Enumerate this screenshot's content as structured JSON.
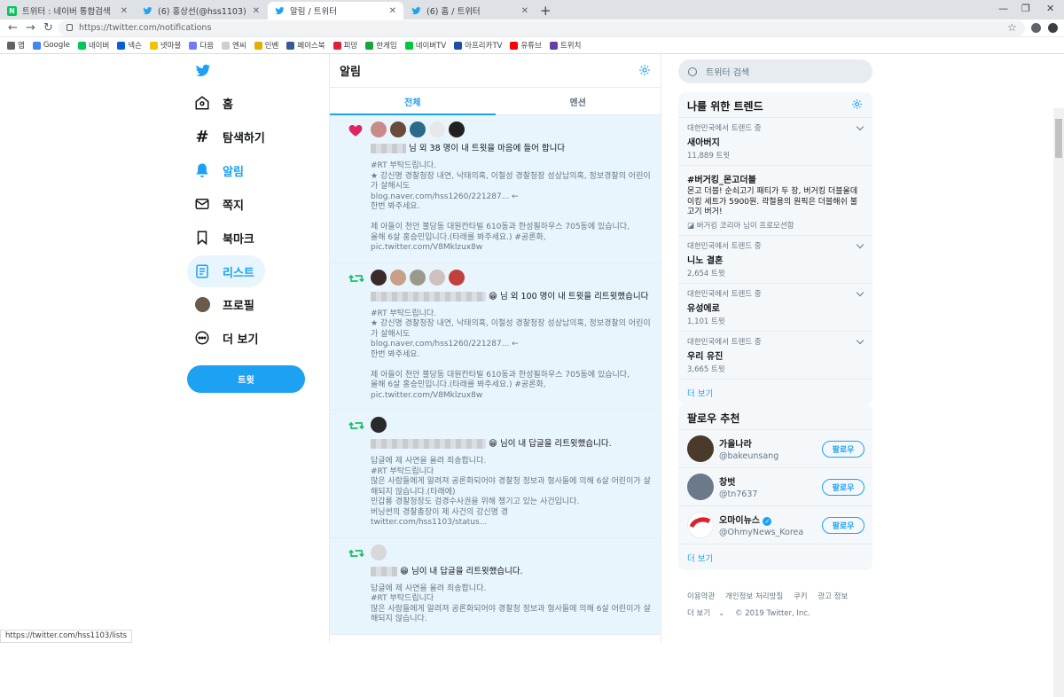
{
  "browser": {
    "tabs": [
      {
        "title": "트위터 : 네이버 통합검색",
        "favicon_color": "#03c75a",
        "favicon_letter": "N"
      },
      {
        "title": "(6) 홍상선(@hss1103) / 트위터",
        "favicon_color": "#1da1f2",
        "favicon_letter": ""
      },
      {
        "title": "알림 / 트위터",
        "favicon_color": "#1da1f2",
        "favicon_letter": ""
      },
      {
        "title": "(6) 홈 / 트위터",
        "favicon_color": "#1da1f2",
        "favicon_letter": ""
      }
    ],
    "url": "https://twitter.com/notifications",
    "bookmarks": [
      {
        "label": "앱",
        "color": "#5f6368"
      },
      {
        "label": "Google",
        "color": "#4285f4"
      },
      {
        "label": "네이버",
        "color": "#03c75a"
      },
      {
        "label": "넥슨",
        "color": "#0b5fd6"
      },
      {
        "label": "넷마블",
        "color": "#f2c200"
      },
      {
        "label": "다음",
        "color": "#6f7cf7"
      },
      {
        "label": "엔씨",
        "color": "#cfcfcf"
      },
      {
        "label": "인벤",
        "color": "#e0b000"
      },
      {
        "label": "페이스북",
        "color": "#3b5998"
      },
      {
        "label": "피망",
        "color": "#e0203a"
      },
      {
        "label": "한게임",
        "color": "#19a33f"
      },
      {
        "label": "네이버TV",
        "color": "#00c73c"
      },
      {
        "label": "아프리카TV",
        "color": "#1f4ea3"
      },
      {
        "label": "유튜브",
        "color": "#ff0000"
      },
      {
        "label": "트위치",
        "color": "#6441a5"
      }
    ],
    "status_url": "https://twitter.com/hss1103/lists"
  },
  "nav": {
    "items": [
      {
        "label": "홈",
        "icon": "home-icon"
      },
      {
        "label": "탐색하기",
        "icon": "hashtag-icon"
      },
      {
        "label": "알림",
        "icon": "bell-icon"
      },
      {
        "label": "쪽지",
        "icon": "mail-icon"
      },
      {
        "label": "북마크",
        "icon": "bookmark-icon"
      },
      {
        "label": "리스트",
        "icon": "list-icon"
      },
      {
        "label": "프로필",
        "icon": "avatar"
      },
      {
        "label": "더 보기",
        "icon": "more-icon"
      }
    ],
    "tweet_button": "트윗"
  },
  "main": {
    "title": "알림",
    "tabs": [
      "전체",
      "멘션"
    ],
    "notifications": [
      {
        "type": "like",
        "summary_pre": "",
        "summary": "님 외 38 명이 내 트윗을 마음에 들어 합니다",
        "body": "#RT 부탁드립니다.\n★ 강신명 경찰청장 내연, 낙태의혹, 이철성 경찰청장 성상납의혹, 정보경찰의 어린이가 살해시도\nblog.naver.com/hss1260/221287... ←\n한번 봐주세요.\n\n제 아들이 천안 불당동 대원칸타빌 610동과 한성필하우스 705동에 있습니다,\n올해 6살 홍승민입니다.(타래를 봐주세요.) #공론화,\npic.twitter.com/V8Mklzux8w",
        "avatars": [
          "#c98a8a",
          "#6a4a3a",
          "#2a6a8a",
          "#e8e8e8",
          "#222222"
        ]
      },
      {
        "type": "retweet",
        "summary": "😁 님 외 100 명이 내 트윗을 리트윗했습니다",
        "body": "#RT 부탁드립니다.\n★ 강신명 경찰청장 내연, 낙태의혹, 이철성 경찰청장 성상납의혹, 정보경찰의 어린이가 살해시도\nblog.naver.com/hss1260/221287... ←\n한번 봐주세요.\n\n제 아들이 천안 불당동 대원칸타빌 610동과 한성필하우스 705동에 있습니다,\n올해 6살 홍승민입니다.(타래를 봐주세요.) #공론화,\npic.twitter.com/V8Mklzux8w",
        "avatars": [
          "#3a2a2a",
          "#c8a088",
          "#9a9a8a",
          "#d0c0c0",
          "#c04040"
        ]
      },
      {
        "type": "retweet",
        "summary": "😁 님이 내 답글을 리트윗했습니다.",
        "body": "답글에 제 사연을 올려 죄송합니다.\n#RT 부탁드립니다\n많은 사람들에게 알려져 공론화되어야 경찰청 정보과 형사들에 의해 6살 어린이가 살해되지 않습니다.(타래에)\n민갑룡 경찰청장도 검경수사권을 위해 챙기고 있는 사건입니다.\n버닝썬의 경찰총장이 제 사건의 강신명 경\ntwitter.com/hss1103/status...",
        "avatars": [
          "#2a2a2a"
        ]
      },
      {
        "type": "retweet",
        "summary": "😁 님이 내 답글을 리트윗했습니다.",
        "body": "답글에 제 사연을 올려 죄송합니다.\n#RT 부탁드립니다\n많은 사람들에게 알려져 공론화되어야 경찰청 정보과 형사들에 의해 6살 어린이가 살해되지 않습니다.",
        "avatars": [
          "#d8d8d8"
        ]
      }
    ]
  },
  "side": {
    "search_placeholder": "트위터 검색",
    "trends_title": "나를 위한 트렌드",
    "trends": [
      {
        "context": "대한민국에서 트렌드 중",
        "name": "새아버지",
        "count": "11,889 트윗"
      },
      {
        "context": "",
        "name": "#버거킹_몬고더블",
        "desc": "몬고 더블! 순쇠고기 패티가 두 장, 버거킹 더블올데이킹 세트가 5900원. 곽철용의 원픽은 더블해쉬 불고기 버거!",
        "promo": "버거킹 코리아 님이 프로모션함"
      },
      {
        "context": "대한민국에서 트렌드 중",
        "name": "니노 결혼",
        "count": "2,654 트윗"
      },
      {
        "context": "대한민국에서 트렌드 중",
        "name": "유성에로",
        "count": "1,101 트윗"
      },
      {
        "context": "대한민국에서 트렌드 중",
        "name": "우리 유진",
        "count": "3,665 트윗"
      }
    ],
    "trends_more": "더 보기",
    "follow_title": "팔로우 추천",
    "follows": [
      {
        "name": "가을나라",
        "handle": "@bakeunsang",
        "color": "#4a3a2a"
      },
      {
        "name": "창벗",
        "handle": "@tn7637",
        "color": "#6a7a8a"
      },
      {
        "name": "오마이뉴스",
        "handle": "@OhmyNews_Korea",
        "color": "#ffffff"
      }
    ],
    "follow_button": "팔로우",
    "follow_more": "더 보기",
    "footer": [
      "이용약관",
      "개인정보 처리방침",
      "쿠키",
      "광고 정보",
      "더 보기",
      "© 2019 Twitter, Inc."
    ]
  }
}
